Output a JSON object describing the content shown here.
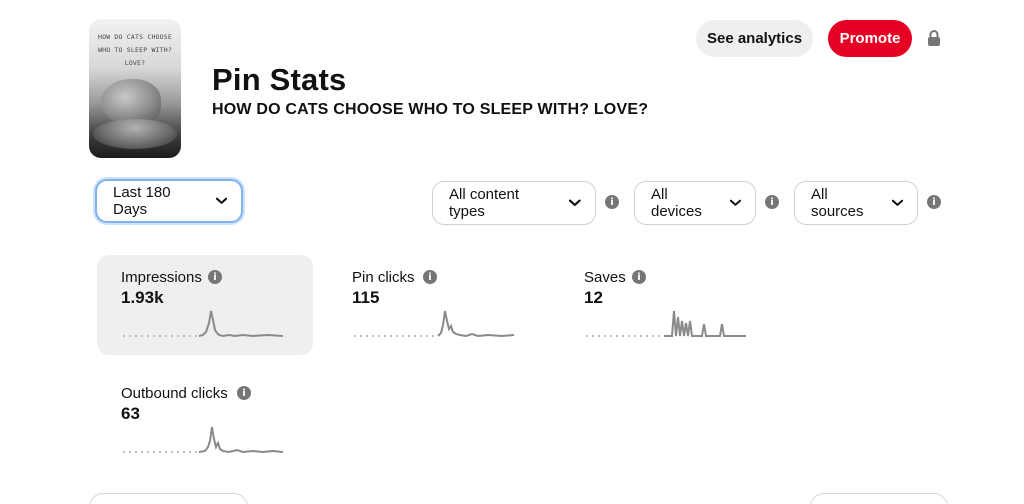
{
  "pin": {
    "thumbnail_text": "HOW DO CATS CHOOSE WHO TO SLEEP WITH? LOVE?",
    "page_title": "Pin Stats",
    "title": "HOW DO CATS CHOOSE WHO TO SLEEP WITH? LOVE?"
  },
  "header": {
    "analytics_label": "See analytics",
    "promote_label": "Promote",
    "promote_color": "#e60023"
  },
  "filters": {
    "date_range": "Last 180 Days",
    "content_type": "All content types",
    "devices": "All devices",
    "sources": "All sources"
  },
  "metrics": [
    {
      "label": "Impressions",
      "value": "1.93k",
      "selected": true
    },
    {
      "label": "Pin clicks",
      "value": "115",
      "selected": false
    },
    {
      "label": "Saves",
      "value": "12",
      "selected": false
    },
    {
      "label": "Outbound clicks",
      "value": "63",
      "selected": false
    }
  ]
}
